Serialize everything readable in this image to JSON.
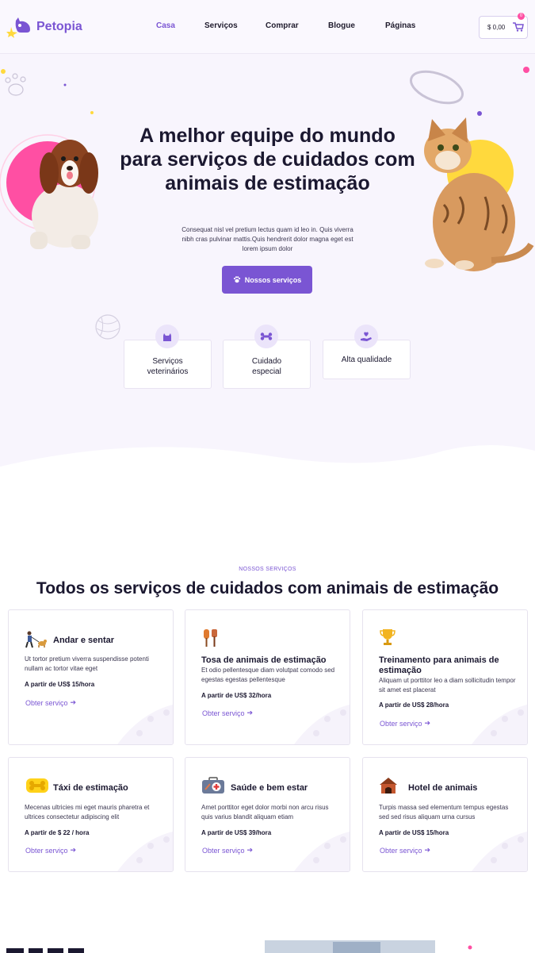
{
  "brand": {
    "name": "Petopia"
  },
  "nav": {
    "items": [
      {
        "label": "Casa",
        "active": true
      },
      {
        "label": "Serviços",
        "active": false
      },
      {
        "label": "Comprar",
        "active": false
      },
      {
        "label": "Blogue",
        "active": false
      },
      {
        "label": "Páginas",
        "active": false
      }
    ]
  },
  "cart": {
    "amount": "$ 0,00",
    "count": "0"
  },
  "hero": {
    "title": "A melhor equipe do mundo para serviços de cuidados com animais de estimação",
    "description": "Consequat nisl vel pretium lectus quam id leo in. Quis viverra nibh cras pulvinar mattis.Quis hendrerit dolor magna eget est lorem ipsum dolor",
    "button_label": "Nossos serviços",
    "features": [
      {
        "label": "Serviços veterinários",
        "icon": "cat-icon"
      },
      {
        "label": "Cuidado especial",
        "icon": "bone-icon"
      },
      {
        "label": "Alta qualidade",
        "icon": "heart-hand-icon"
      }
    ]
  },
  "services": {
    "eyebrow": "NOSSOS SERVIÇOS",
    "title": "Todos os serviços de cuidados com animais de estimação",
    "cards": [
      {
        "title": "Andar e sentar",
        "description": "Ut tortor pretium viverra suspendisse potenti nullam ac tortor vitae eget",
        "price": "A partir de US$ 15/hora",
        "link": "Obter serviço",
        "icon": "dog-walking-icon"
      },
      {
        "title": "Tosa de animais de estimação",
        "description": "Et odio pellentesque diam volutpat comodo sed egestas egestas pellentesque",
        "price": "A partir de US$ 32/hora",
        "link": "Obter serviço",
        "icon": "brush-icon"
      },
      {
        "title": "Treinamento para animais de estimação",
        "description": "Aliquam ut porttitor leo a diam sollicitudin tempor sit amet est placerat",
        "price": "A partir de US$ 28/hora",
        "link": "Obter serviço",
        "icon": "trophy-icon"
      },
      {
        "title": "Táxi de estimação",
        "description": "Mecenas ultricies mi eget mauris pharetra et ultrices consectetur adipiscing elit",
        "price": "A partir de $ 22 / hora",
        "link": "Obter serviço",
        "icon": "bone-bubble-icon"
      },
      {
        "title": "Saúde e bem estar",
        "description": "Amet porttitor eget dolor morbi non arcu risus quis varius blandit aliquam etiam",
        "price": "A partir de US$ 39/hora",
        "link": "Obter serviço",
        "icon": "medical-kit-icon"
      },
      {
        "title": "Hotel de animais",
        "description": "Turpis massa sed elementum tempus egestas sed sed risus aliquam urna cursus",
        "price": "A partir de US$ 15/hora",
        "link": "Obter serviço",
        "icon": "pet-house-icon"
      }
    ]
  },
  "colors": {
    "accent": "#7a55d3",
    "pink": "#ff4fa3",
    "yellow": "#ffd93d",
    "hero_bg": "#f8f5fd"
  }
}
